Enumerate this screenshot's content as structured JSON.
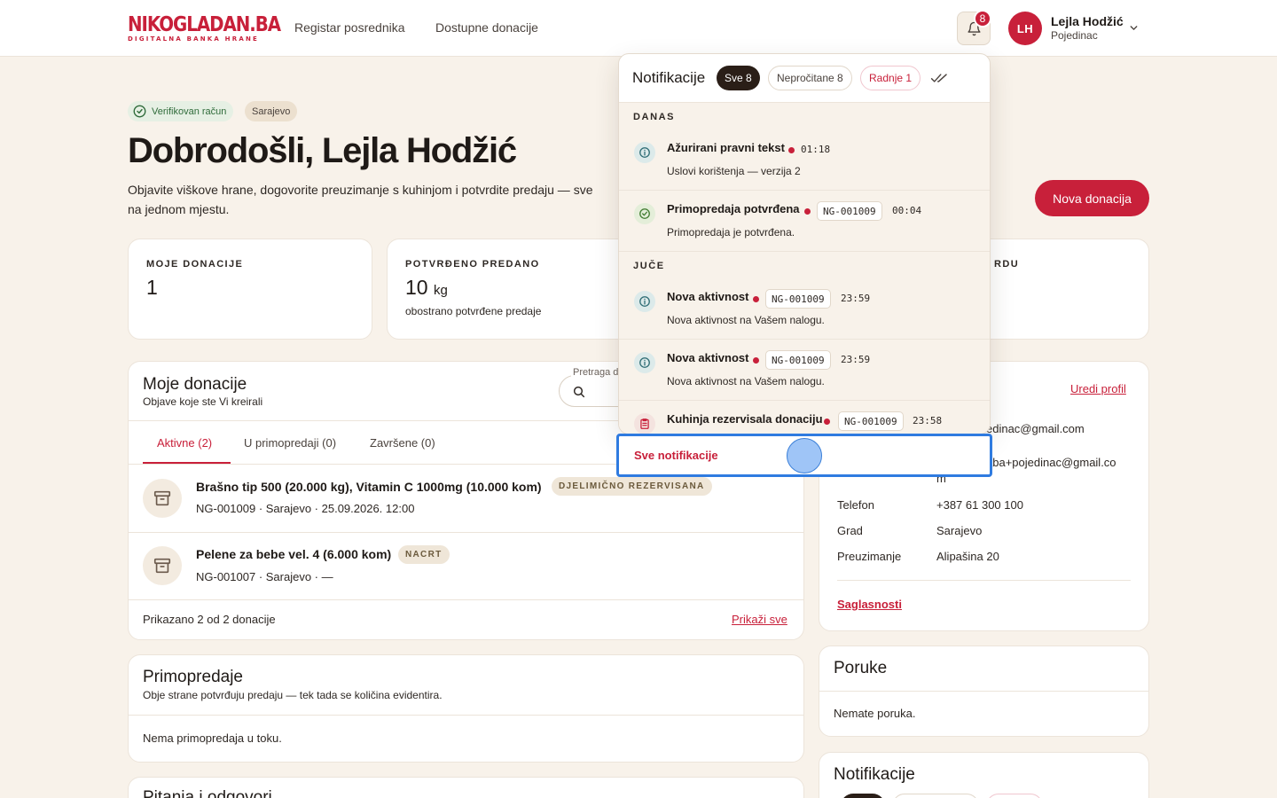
{
  "header": {
    "logo_main": "NIKOGLADAN.BA",
    "logo_sub": "DIGITALNA BANKA HRANE",
    "nav": [
      "Registar posrednika",
      "Dostupne donacije"
    ],
    "notification_count": "8",
    "user": {
      "initials": "LH",
      "name": "Lejla Hodžić",
      "role": "Pojedinac"
    }
  },
  "hero": {
    "verified": "Verifikovan račun",
    "city": "Sarajevo",
    "title": "Dobrodošli, Lejla Hodžić",
    "description": "Objavite viškove hrane, dogovorite preuzimanje s kuhinjom i potvrdite predaju — sve na jednom mjestu.",
    "new_donation": "Nova donacija"
  },
  "stats": [
    {
      "label": "MOJE DONACIJE",
      "value": "1"
    },
    {
      "label": "POTVRĐENO PREDANO",
      "value": "10",
      "unit": "kg",
      "sub": "obostrano potvrđene predaje"
    },
    {
      "label_fragment": "RDU"
    }
  ],
  "donations": {
    "title": "Moje donacije",
    "subtitle": "Objave koje ste Vi kreirali",
    "search_label": "Pretraga d",
    "tabs": [
      "Aktivne (2)",
      "U primopredaji (0)",
      "Završene (0)"
    ],
    "items": [
      {
        "title": "Brašno tip 500 (20.000 kg), Vitamin C 1000mg (10.000 kom)",
        "status": "DJELIMIČNO REZERVISANA",
        "meta": "NG-001009 · Sarajevo · 25.09.2026. 12:00"
      },
      {
        "title": "Pelene za bebe vel. 4 (6.000 kom)",
        "status": "NACRT",
        "meta": "NG-001007 · Sarajevo · —"
      }
    ],
    "footer_count": "Prikazano 2 od 2 donacije",
    "show_all": "Prikaži sve"
  },
  "handovers": {
    "title": "Primopredaje",
    "subtitle": "Obje strane potvrđuju predaju — tek tada se količina evidentira.",
    "empty": "Nema primopredaja u toku."
  },
  "qa": {
    "title": "Pitanja i odgovori"
  },
  "profile": {
    "edit": "Uredi profil",
    "email_fragment": "edinac@gmail.com",
    "email2_fragment_1": "aba+pojedinac@gmail.co",
    "email2_fragment_2": "m",
    "rows": [
      {
        "label": "Telefon",
        "value": "+387 61 300 100"
      },
      {
        "label": "Grad",
        "value": "Sarajevo"
      },
      {
        "label": "Preuzimanje",
        "value": "Alipašina 20"
      }
    ],
    "consents": "Saglasnosti"
  },
  "messages": {
    "title": "Poruke",
    "empty": "Nemate poruka."
  },
  "notifications_card": {
    "title": "Notifikacije"
  },
  "dropdown": {
    "title": "Notifikacije",
    "chips": {
      "all": "Sve 8",
      "unread": "Nepročitane 8",
      "recent": "Radnje 1"
    },
    "section_today": "DANAS",
    "section_yesterday": "JUČE",
    "items": [
      {
        "icon": "info-icon",
        "title": "Ažurirani pravni tekst",
        "code": "",
        "time": "01:18",
        "body": "Uslovi korištenja — verzija 2"
      },
      {
        "icon": "check-icon",
        "title": "Primopredaja potvrđena",
        "code": "NG-001009",
        "time": "00:04",
        "body": "Primopredaja je potvrđena."
      },
      {
        "icon": "info-icon",
        "title": "Nova aktivnost",
        "code": "NG-001009",
        "time": "23:59",
        "body": "Nova aktivnost na Vašem nalogu."
      },
      {
        "icon": "info-icon",
        "title": "Nova aktivnost",
        "code": "NG-001009",
        "time": "23:59",
        "body": "Nova aktivnost na Vašem nalogu."
      },
      {
        "icon": "clipboard-icon",
        "title": "Kuhinja rezervisala donaciju",
        "code": "NG-001009",
        "time": "23:58",
        "body": ""
      }
    ],
    "footer": "Sve notifikacije"
  },
  "colors": {
    "accent": "#c8203a",
    "background": "#f8f2ea",
    "focus": "#2f7be0"
  }
}
